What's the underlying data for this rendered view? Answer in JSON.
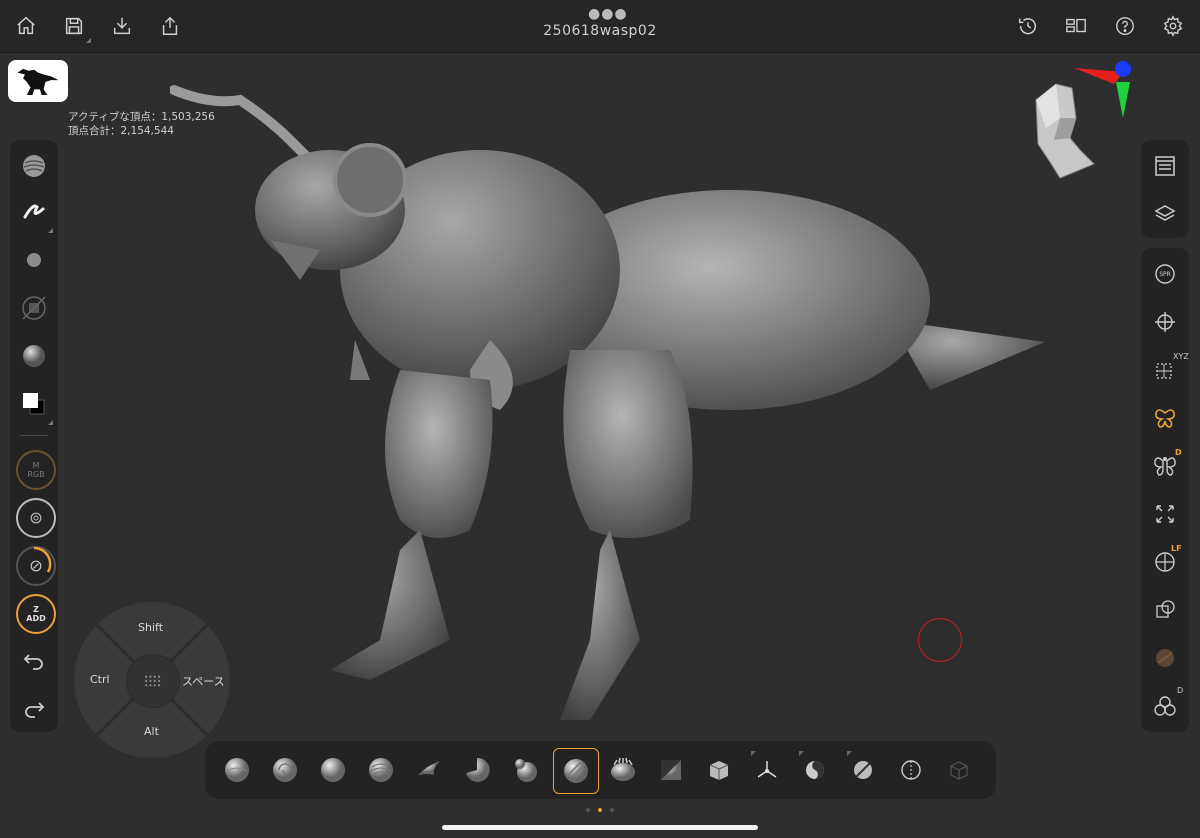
{
  "window": {
    "title": "250618wasp02"
  },
  "topbar": {
    "left_icons": [
      "home-icon",
      "save-icon",
      "import-icon",
      "share-icon"
    ],
    "right_icons": [
      "history-icon",
      "layout-icon",
      "help-icon",
      "settings-icon"
    ]
  },
  "stats": {
    "active_vertices": "アクティブな頂点：1,503,256",
    "total_vertices": "頂点合計：2,154,544"
  },
  "left_toolbar": {
    "color_toggle_label": "M\nRGB",
    "add_label": "Z\nADD"
  },
  "right_toolbar": {
    "spr_label": "SPR",
    "xyz_label": "XYZ",
    "d_label": "D",
    "lf_label": "LF",
    "d2_label": "D"
  },
  "dpad": {
    "top": "Shift",
    "left": "Ctrl",
    "right": "スペース",
    "bottom": "Alt"
  },
  "brushes": [
    "standard",
    "clay",
    "smooth",
    "dam-standard",
    "move",
    "inflate",
    "pinch",
    "clay-buildup",
    "chisel",
    "trim",
    "mask",
    "gizmo",
    "select",
    "slice",
    "planar",
    "boolean"
  ],
  "colors": {
    "accent": "#e8a23a",
    "gizmo_x": "#e3201b",
    "gizmo_y": "#1fd33a",
    "gizmo_z": "#1a3cff",
    "cursor": "#c8201f"
  }
}
